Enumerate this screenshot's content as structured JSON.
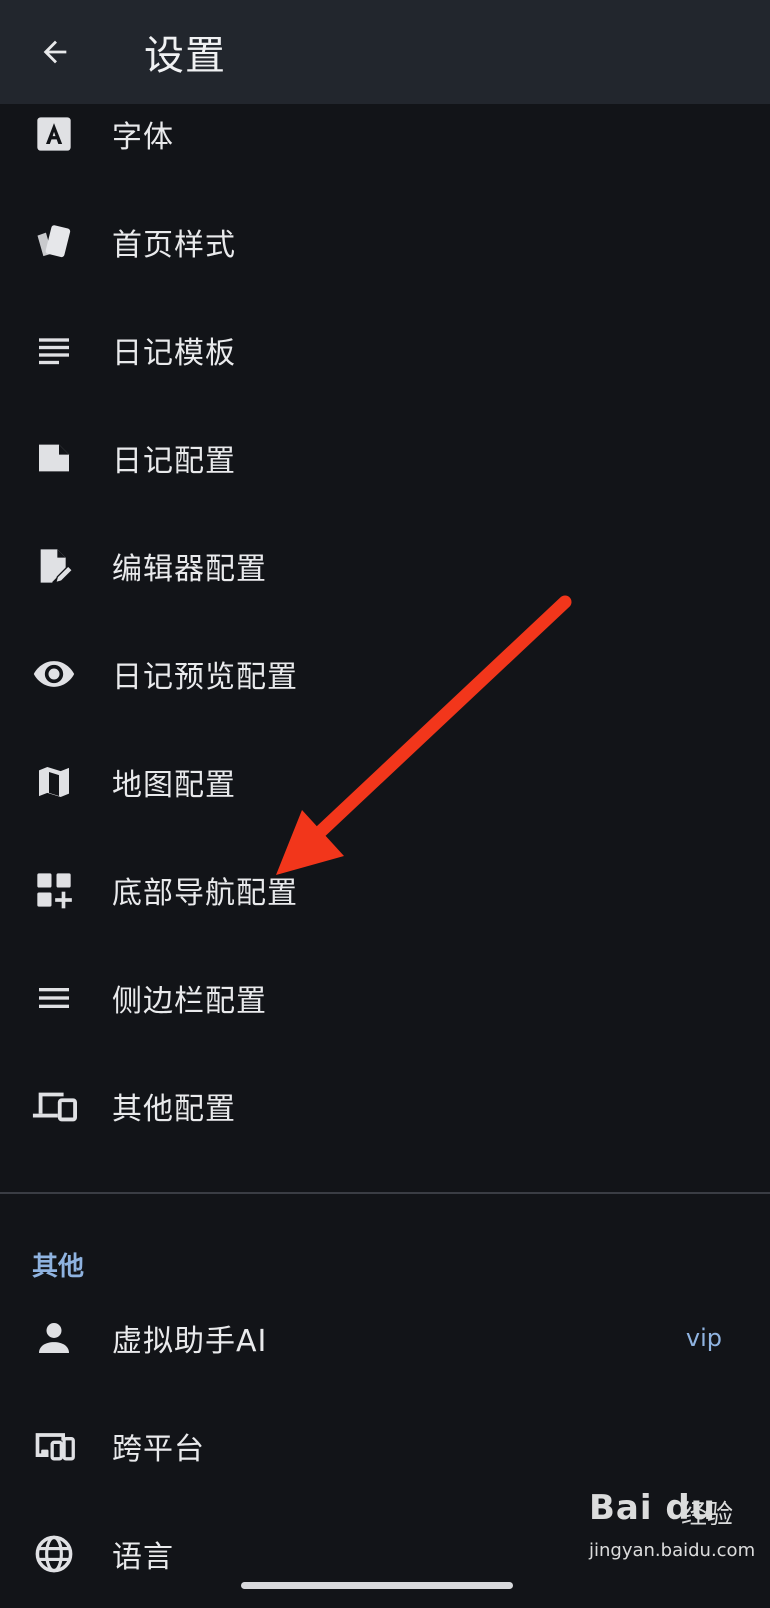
{
  "appbar": {
    "title": "设置",
    "back_icon": "arrow-left-icon"
  },
  "items": [
    {
      "label": "字体",
      "icon": "font-icon"
    },
    {
      "label": "首页样式",
      "icon": "cards-icon"
    },
    {
      "label": "日记模板",
      "icon": "notes-lines-icon"
    },
    {
      "label": "日记配置",
      "icon": "note-icon"
    },
    {
      "label": "编辑器配置",
      "icon": "edit-file-icon"
    },
    {
      "label": "日记预览配置",
      "icon": "eye-icon"
    },
    {
      "label": "地图配置",
      "icon": "map-icon"
    },
    {
      "label": "底部导航配置",
      "icon": "grid-plus-icon"
    },
    {
      "label": "侧边栏配置",
      "icon": "menu-icon"
    },
    {
      "label": "其他配置",
      "icon": "devices-icon"
    }
  ],
  "section_other": {
    "title": "其他"
  },
  "other_items": [
    {
      "label": "虚拟助手AI",
      "icon": "person-icon",
      "badge": "vip"
    },
    {
      "label": "跨平台",
      "icon": "cross-platform-icon"
    },
    {
      "label": "语言",
      "icon": "globe-icon"
    }
  ],
  "watermark": {
    "logo": "Bai du",
    "cn": "经验",
    "url": "jingyan.baidu.com"
  },
  "colors": {
    "background": "#121418",
    "appbar": "#22262d",
    "accent": "#8fb3e0",
    "arrow": "#f2361b"
  }
}
